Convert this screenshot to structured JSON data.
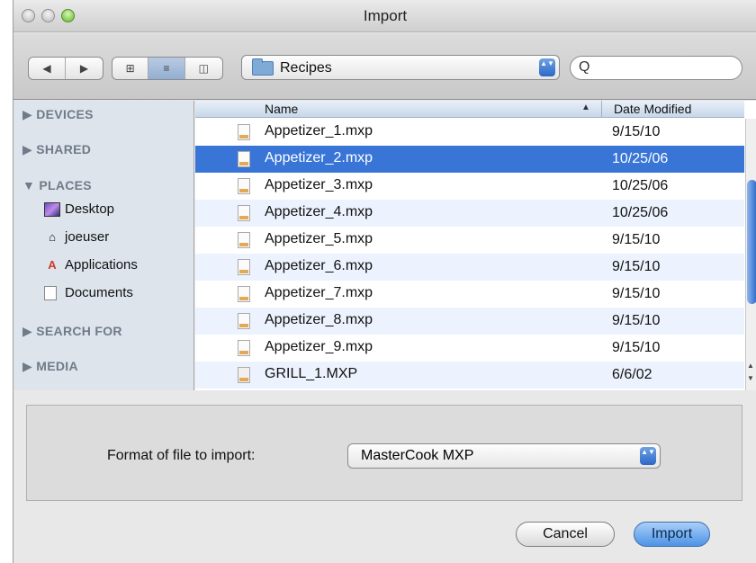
{
  "window": {
    "title": "Import"
  },
  "toolbar": {
    "nav_back": "◀",
    "nav_forward": "▶",
    "view_icons": "⊞",
    "view_list": "≡",
    "view_columns": "◫",
    "location": "Recipes",
    "stepper": "▲▼",
    "search_glyph": "Q",
    "search_value": ""
  },
  "sidebar": {
    "devices": "▶ DEVICES",
    "shared": "▶ SHARED",
    "places": "▼ PLACES",
    "places_items": [
      {
        "label": "Desktop",
        "icon": "desktop-icon"
      },
      {
        "label": "joeuser",
        "icon": "home-icon"
      },
      {
        "label": "Applications",
        "icon": "applications-icon"
      },
      {
        "label": "Documents",
        "icon": "documents-icon"
      }
    ],
    "search_for": "▶ SEARCH FOR",
    "media": "▶ MEDIA"
  },
  "file_list": {
    "col_name": "Name",
    "col_date": "Date Modified",
    "sort_indicator": "▲",
    "rows": [
      {
        "name": "Appetizer_1.mxp",
        "date": "9/15/10"
      },
      {
        "name": "Appetizer_2.mxp",
        "date": "10/25/06",
        "selected": true
      },
      {
        "name": "Appetizer_3.mxp",
        "date": "10/25/06"
      },
      {
        "name": "Appetizer_4.mxp",
        "date": "10/25/06"
      },
      {
        "name": "Appetizer_5.mxp",
        "date": "9/15/10"
      },
      {
        "name": "Appetizer_6.mxp",
        "date": "9/15/10"
      },
      {
        "name": "Appetizer_7.mxp",
        "date": "9/15/10"
      },
      {
        "name": "Appetizer_8.mxp",
        "date": "9/15/10"
      },
      {
        "name": "Appetizer_9.mxp",
        "date": "9/15/10"
      },
      {
        "name": "GRILL_1.MXP",
        "date": "6/6/02"
      }
    ]
  },
  "format": {
    "label": "Format of file to import:",
    "value": "MasterCook MXP"
  },
  "buttons": {
    "cancel": "Cancel",
    "import": "Import"
  },
  "colors": {
    "selection": "#3875d7",
    "accent": "#4d93e6",
    "sidebar_bg": "#dde4ec"
  }
}
